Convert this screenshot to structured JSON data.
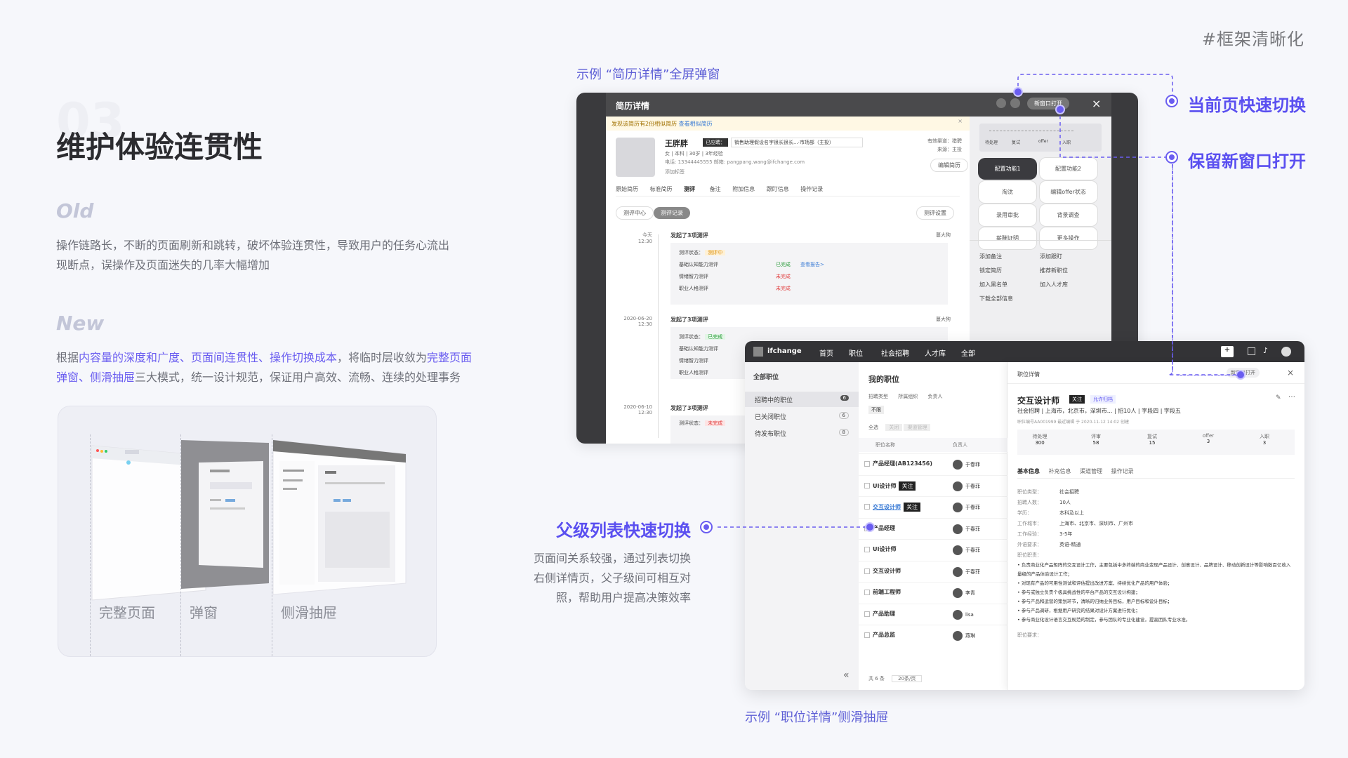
{
  "tag": "#框架清晰化",
  "section_number": "03",
  "heading": "维护体验连贯性",
  "old": {
    "label": "Old",
    "desc": "操作链路长，不断的页面刷新和跳转，破坏体验连贯性，导致用户的任务心流出现断点，误操作及页面迷失的几率大幅增加"
  },
  "new": {
    "label": "New",
    "p1": "根据",
    "h1": "内容量的深度和广度、页面间连贯性、操作切换成本",
    "p2": "，将临时层收敛为",
    "h2": "完整页面弹窗、侧滑抽屉",
    "p3": "三大模式，统一设计规范，保证用户高效、流畅、连续的处理事务"
  },
  "modes": [
    "完整页面",
    "弹窗",
    "侧滑抽屉"
  ],
  "example1_caption": "示例 “简历详情”全屏弹窗",
  "example2_caption": "示例 “职位详情”侧滑抽屉",
  "callouts": {
    "quick_switch": "当前页快速切换",
    "new_window": "保留新窗口打开",
    "parent_list": "父级列表快速切换",
    "parent_desc_1": "页面间关系较强，通过列表切换",
    "parent_desc_2": "右侧详情页，父子级间可相互对",
    "parent_desc_3": "照，帮助用户提高决策效率"
  },
  "resume": {
    "title": "简历详情",
    "open_new": "新窗口打开",
    "warning": "发现该简历有2份相似简历",
    "warning_link": "查看相似简历",
    "name": "王胖胖",
    "status": "已应聘：",
    "position": "销售助理假设名字很长很长...·市场部（主投）",
    "meta": "女  |  本科  |  30岁  |  3年经验",
    "contact": "电话: 13344445555      邮箱: pangpang.wang@ifchange.com",
    "add_tag": "添加标签",
    "edit_resume": "编辑简历",
    "valid_source": "有效渠道：猎聘",
    "source": "来源：主投",
    "tabs": [
      "原始简历",
      "标准简历",
      "测评",
      "备注",
      "附加信息",
      "跟盯信息",
      "操作记录"
    ],
    "subtabs": [
      "测评中心",
      "测评记录"
    ],
    "eval_settings": "测评设置",
    "records": [
      {
        "date": "今天",
        "time": "12:30",
        "title": "发起了3项测评",
        "by": "蔓大狗",
        "status": "测评中",
        "items": [
          [
            "基础认知能力测评",
            "已完成",
            "查看报告>"
          ],
          [
            "情绪智力测评",
            "未完成",
            ""
          ],
          [
            "职业人格测评",
            "未完成",
            ""
          ]
        ]
      },
      {
        "date": "2020-06-20",
        "time": "12:30",
        "title": "发起了3项测评",
        "by": "蔓大狗",
        "status": "已完成",
        "items": [
          [
            "基础认知能力测评",
            "",
            ""
          ],
          [
            "情绪智力测评",
            "",
            ""
          ],
          [
            "职业人格测评",
            "",
            ""
          ]
        ]
      },
      {
        "date": "2020-06-10",
        "time": "12:30",
        "title": "发起了3项测评",
        "by": "蔓大狗",
        "status": "未完成",
        "items": []
      }
    ],
    "eval_status_label": "测评状态：",
    "pipeline": [
      "待处理",
      "复试",
      "offer",
      "入职"
    ],
    "actions": [
      "配置功能1",
      "配置功能2",
      "淘汰",
      "编辑offer状态",
      "录用审批",
      "背景调查",
      "薪酬证明",
      "更多操作"
    ],
    "links": [
      "添加备注",
      "添加跟盯",
      "锁定简历",
      "推荐新职位",
      "加入黑名单",
      "加入人才库",
      "下载全部信息"
    ]
  },
  "jobs": {
    "brand": "ifchange",
    "nav": [
      "首页",
      "职位",
      "社会招聘",
      "人才库",
      "全部"
    ],
    "left_title": "全部职位",
    "left_items": [
      [
        "招聘中的职位",
        "6"
      ],
      [
        "已关闭职位",
        "6"
      ],
      [
        "待发布职位",
        "8"
      ]
    ],
    "mid_title": "我的职位",
    "filters": [
      "招聘类型",
      "所属组织",
      "负责人"
    ],
    "filter_tag": "不限",
    "select_all": "全选",
    "bulk_1": "关闭",
    "bulk_2": "渠道管理",
    "col_name": "职位名称",
    "col_owner": "负责人",
    "follow": "关注",
    "rows": [
      [
        "产品经理(AB123456)",
        "",
        "于春菲"
      ],
      [
        "UI设计师",
        "关注",
        "于春菲"
      ],
      [
        "交互设计师",
        "关注",
        "于春菲"
      ],
      [
        "产品经理",
        "",
        "于春菲"
      ],
      [
        "UI设计师",
        "",
        "于春菲"
      ],
      [
        "交互设计师",
        "",
        "于春菲"
      ],
      [
        "前端工程师",
        "",
        "李青"
      ],
      [
        "产品助理",
        "",
        "lisa"
      ],
      [
        "产品总监",
        "",
        "燕琳"
      ]
    ],
    "total": "共 6 条",
    "page_size": "20条/页",
    "detail": {
      "header": "职位详情",
      "open_new": "新窗口打开",
      "title": "交互设计师",
      "tag_follow": "关注",
      "tag_allow": "允许归档",
      "info": "社会招聘  |  上海市，北京市，深圳市...  |  招10人  |  字段四  |  字段五",
      "sub_info": "职位编号AA001999     最近编辑 于 2020-11-12 14:02 创建",
      "stats": [
        [
          "待处理",
          "300"
        ],
        [
          "评审",
          "58"
        ],
        [
          "复试",
          "15"
        ],
        [
          "offer",
          "3"
        ],
        [
          "入职",
          "3"
        ]
      ],
      "tabs": [
        "基本信息",
        "补充信息",
        "渠道管理",
        "操作记录"
      ],
      "fields": [
        [
          "职位类型：",
          "社会招聘"
        ],
        [
          "招聘人数：",
          "10人"
        ],
        [
          "学历：",
          "本科及以上"
        ],
        [
          "工作城市：",
          "上海市、北京市、深圳市、广州市"
        ],
        [
          "工作经验：",
          "3-5年"
        ],
        [
          "外语要求：",
          "英语-精通"
        ]
      ],
      "duty_label": "职位职责：",
      "duties": [
        "• 负责商业化产品矩阵的交互设计工作，主要包括中多终端的商业变现产品设计、创意设计、品牌设计、移动创新设计等影响数百亿收入量级的产品体验设计工作；",
        "• 对现有产品的可用性测试和评估提出改进方案，持续优化产品的用户体验；",
        "• 参与或独立负责个极具挑战性的平台产品的交互设计构建；",
        "• 参与产品和运营的策划环节，清晰的归纳业务目标，用户目标和设计目标；",
        "• 参与产品调研，根据用户研究的结果对设计方案进行优化；",
        "• 参与商业化设计语言交互规范的制定，参与团队的专业化建设，提高团队专业水准。"
      ],
      "req_label": "职位要求："
    }
  },
  "colors": {
    "accent": "#6a5df0",
    "dark": "#333336"
  }
}
